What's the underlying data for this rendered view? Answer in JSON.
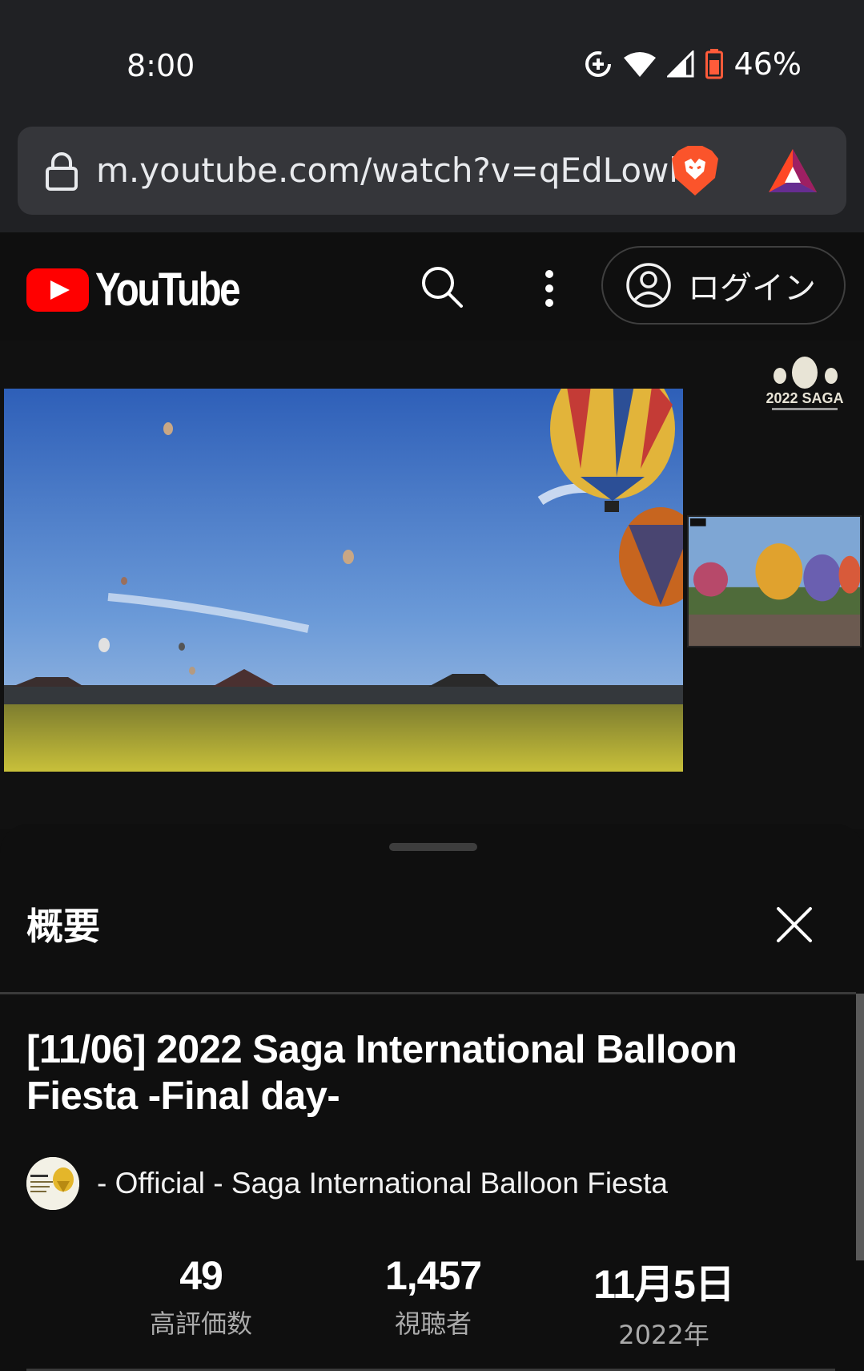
{
  "status_bar": {
    "time": "8:00",
    "battery_percent": "46%",
    "icons": [
      "data-saver-icon",
      "wifi-icon",
      "signal-icon",
      "battery-icon"
    ]
  },
  "browser": {
    "url": "m.youtube.com/watch?v=qEdLowh",
    "icons": [
      "lock-icon",
      "brave-shield-icon",
      "bat-rewards-icon"
    ]
  },
  "header": {
    "wordmark": "YouTube",
    "login_label": "ログイン",
    "icons": [
      "youtube-logo-icon",
      "search-icon",
      "more-vert-icon",
      "account-circle-icon"
    ],
    "brand_color": "#ff0000"
  },
  "video": {
    "overlay_logo_text": "2022 SAGA"
  },
  "description_panel": {
    "heading": "概要",
    "title": "[11/06] 2022 Saga International Balloon Fiesta -Final day-",
    "channel": "- Official - Saga International Balloon Fiesta",
    "stats": [
      {
        "value": "49",
        "label": "高評価数"
      },
      {
        "value": "1,457",
        "label": "視聴者"
      },
      {
        "value": "11月5日",
        "label": "2022年"
      }
    ]
  }
}
